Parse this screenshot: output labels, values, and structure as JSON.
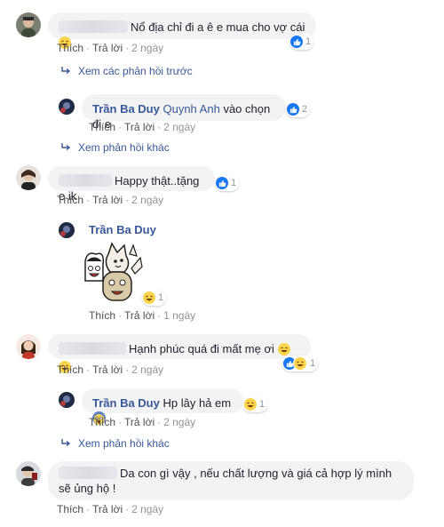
{
  "actions": {
    "like": "Thích",
    "reply": "Trả lời",
    "dot": "·"
  },
  "comments": [
    {
      "text": "Nổ địa chỉ đi a ê e mua cho vợ cái",
      "time": "2 ngày",
      "react_count": "1"
    },
    {
      "text": "Happy thật..tặng e ik",
      "time": "2 ngày",
      "react_count": "1"
    },
    {
      "text": "Hạnh phúc quá đi mất mẹ ơi",
      "time": "2 ngày",
      "react_count": "1"
    },
    {
      "text": "Da con gì vậy , nếu chất lượng và giá cả hợp lý mình sẽ ủng hộ !",
      "time": "2 ngày"
    }
  ],
  "replies": [
    {
      "author": "Trần Ba Duy",
      "mention": "Quynh Anh",
      "text": "vào chọn đi e",
      "time": "2 ngày",
      "react_count": "2"
    },
    {
      "author": "Trần Ba Duy",
      "text": "",
      "time": "1 ngày",
      "react_count": "1"
    },
    {
      "author": "Trần Ba Duy",
      "text": "Hp lây hả em",
      "time": "2 ngày",
      "react_count": "1"
    }
  ],
  "links": {
    "previous_replies": "Xem các phản hồi trước",
    "more_replies_1": "Xem phản hồi khác",
    "more_replies_2": "Xem phản hồi khác"
  },
  "colors": {
    "link": "#385898",
    "like_blue": "#1877f2",
    "bubble": "#f2f3f5",
    "muted": "#90949c"
  }
}
